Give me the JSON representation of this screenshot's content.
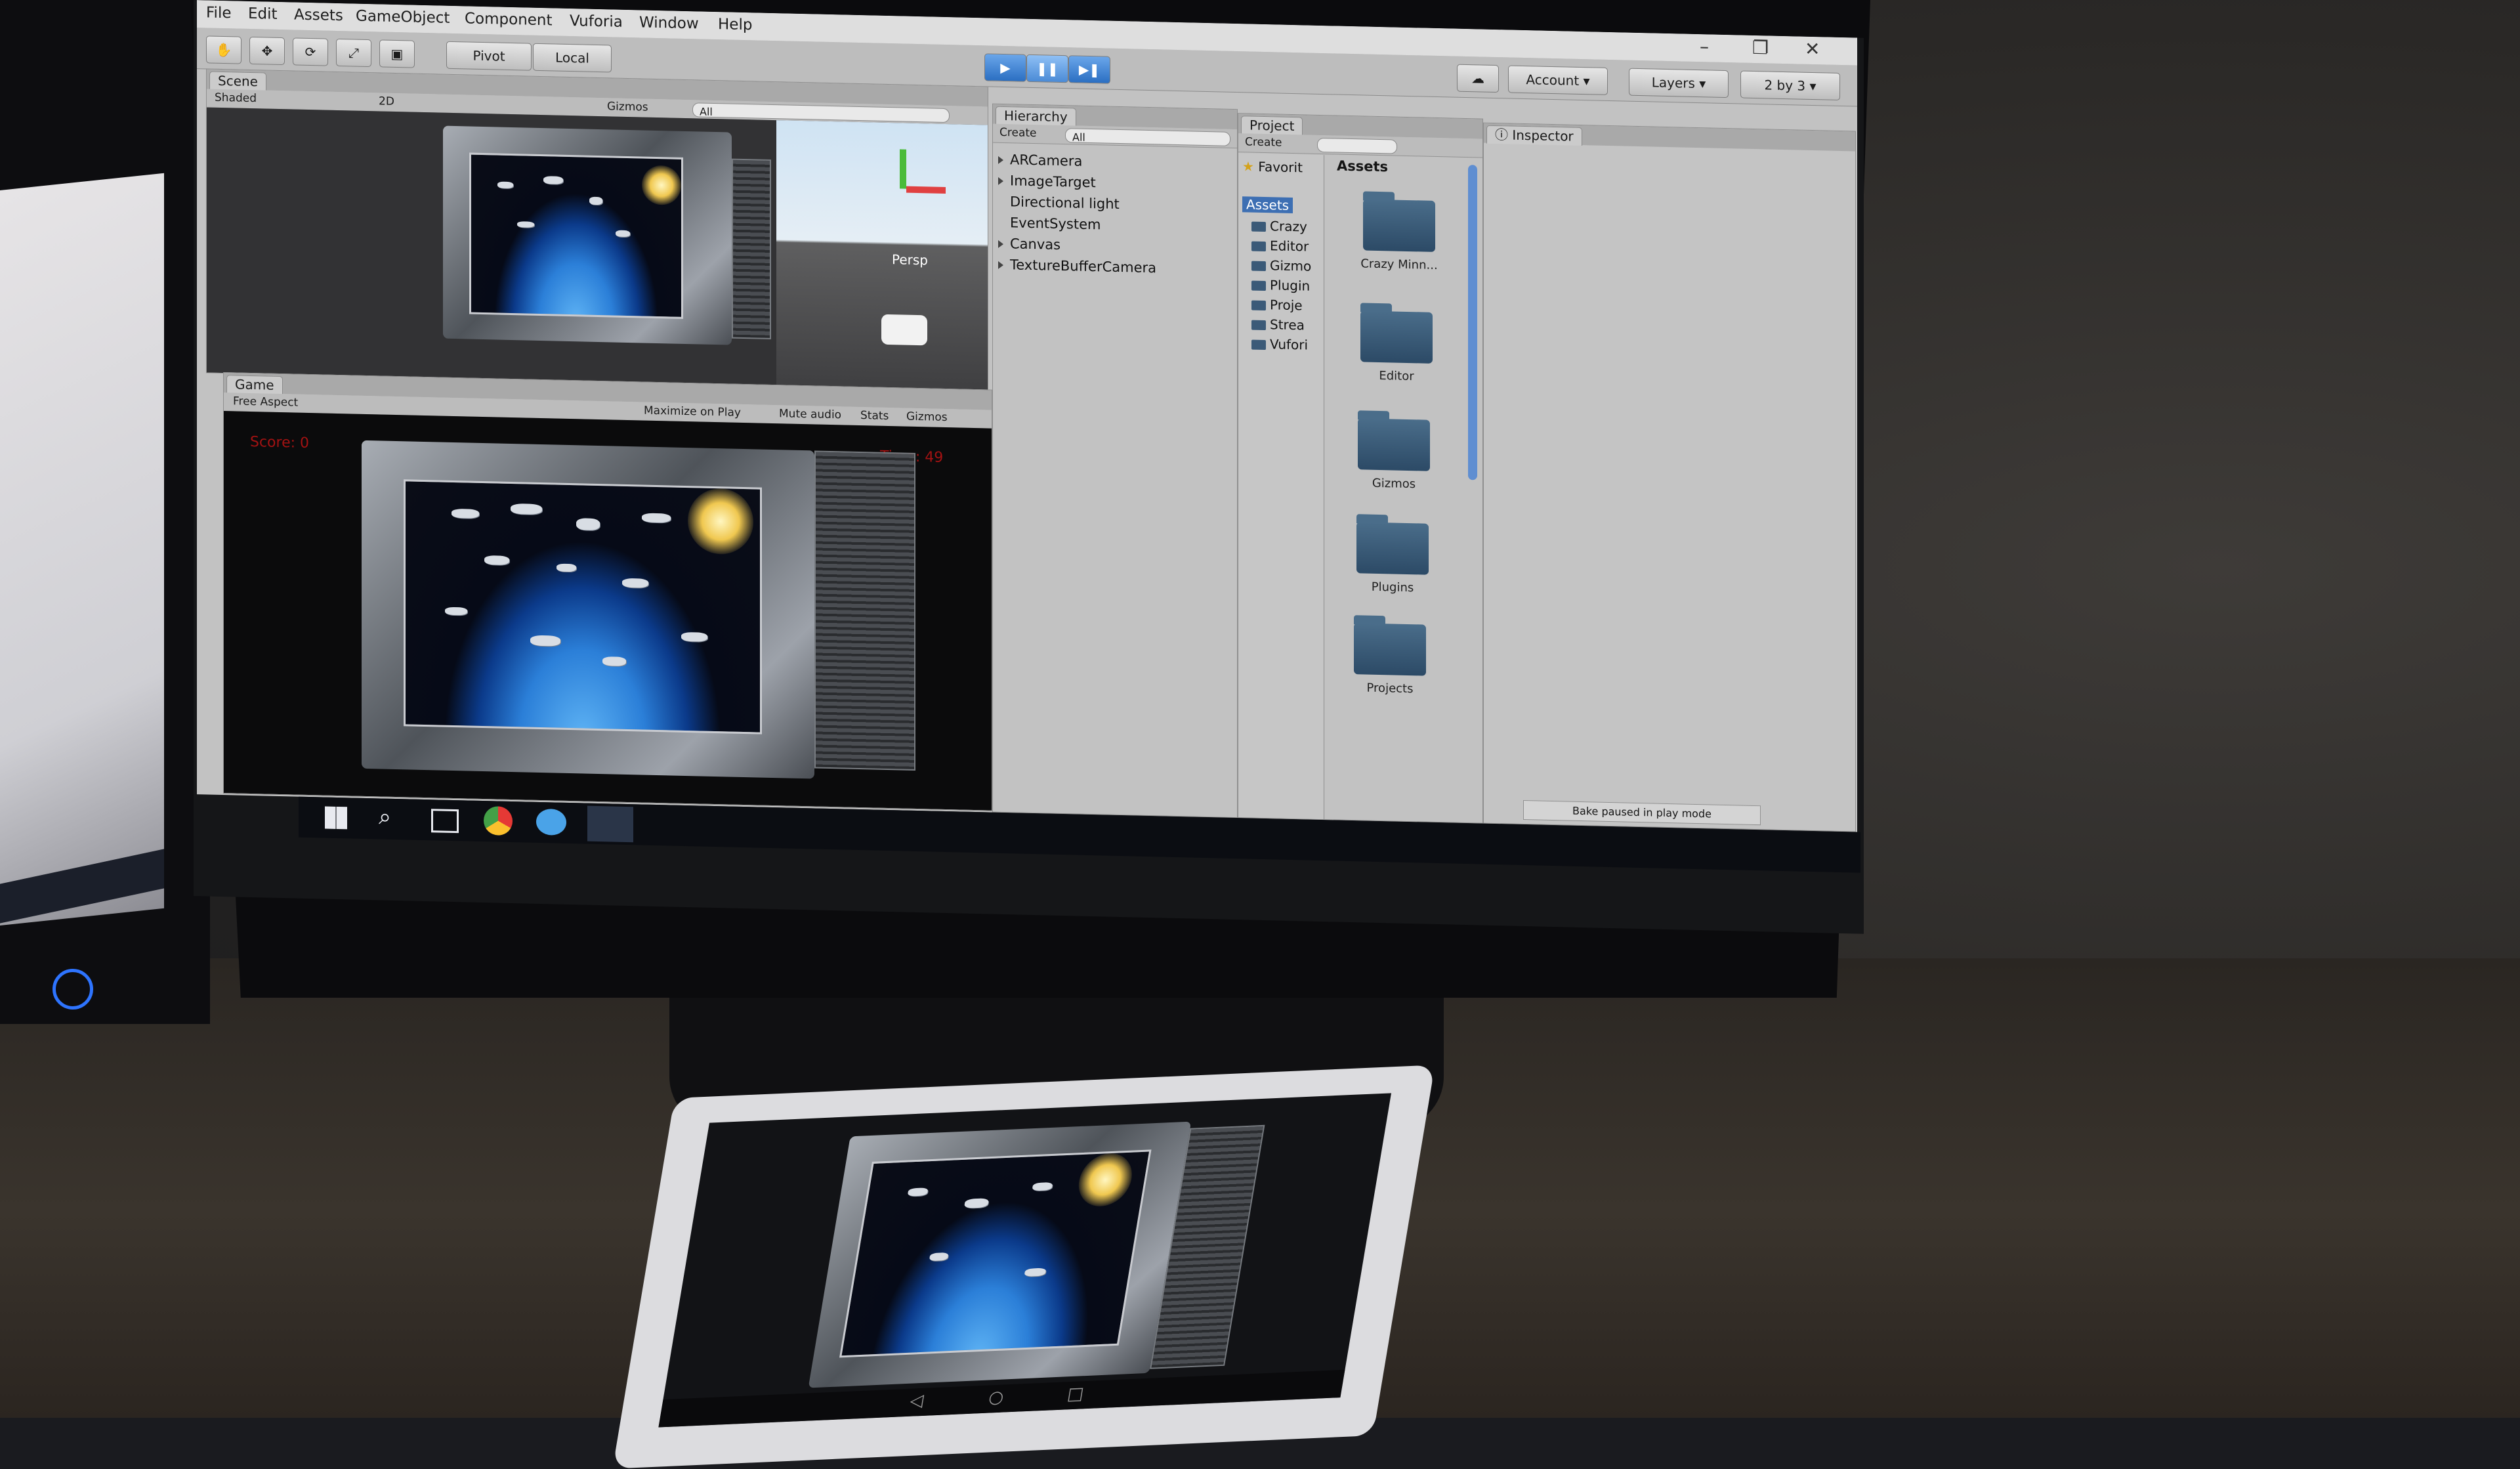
{
  "menubar": {
    "items": [
      "File",
      "Edit",
      "Assets",
      "GameObject",
      "Component",
      "Vuforia",
      "Window",
      "Help"
    ]
  },
  "toolbar": {
    "pivot": "Pivot",
    "local": "Local",
    "account": "Account",
    "layers": "Layers",
    "layout": "2 by 3"
  },
  "scene": {
    "tab": "Scene",
    "shading": "Shaded",
    "mode_2d": "2D",
    "gizmos": "Gizmos",
    "search": "All",
    "persp": "Persp"
  },
  "game": {
    "tab": "Game",
    "aspect": "Free Aspect",
    "maximize": "Maximize on Play",
    "mute": "Mute audio",
    "stats": "Stats",
    "gizmos": "Gizmos",
    "score": "Score: 0",
    "time": "Time: 49"
  },
  "hierarchy": {
    "tab": "Hierarchy",
    "create": "Create",
    "search": "All",
    "items": [
      "ARCamera",
      "ImageTarget",
      "Directional light",
      "EventSystem",
      "Canvas",
      "TextureBufferCamera"
    ]
  },
  "project": {
    "tab": "Project",
    "create": "Create",
    "favorites": "Favorit",
    "assets_root": "Assets",
    "breadcrumb": "Assets",
    "tree": [
      "Crazy",
      "Editor",
      "Gizmo",
      "Plugin",
      "Proje",
      "Strea",
      "Vufori"
    ],
    "folders": [
      "Crazy Minn...",
      "Editor",
      "Gizmos",
      "Plugins",
      "Projects"
    ]
  },
  "inspector": {
    "tab": "Inspector"
  },
  "status": {
    "message": "Bake paused in play mode"
  },
  "colors": {
    "play_blue": "#2b6fc2",
    "panel_grey": "#c2c2c2",
    "hud_red": "#a31212"
  }
}
